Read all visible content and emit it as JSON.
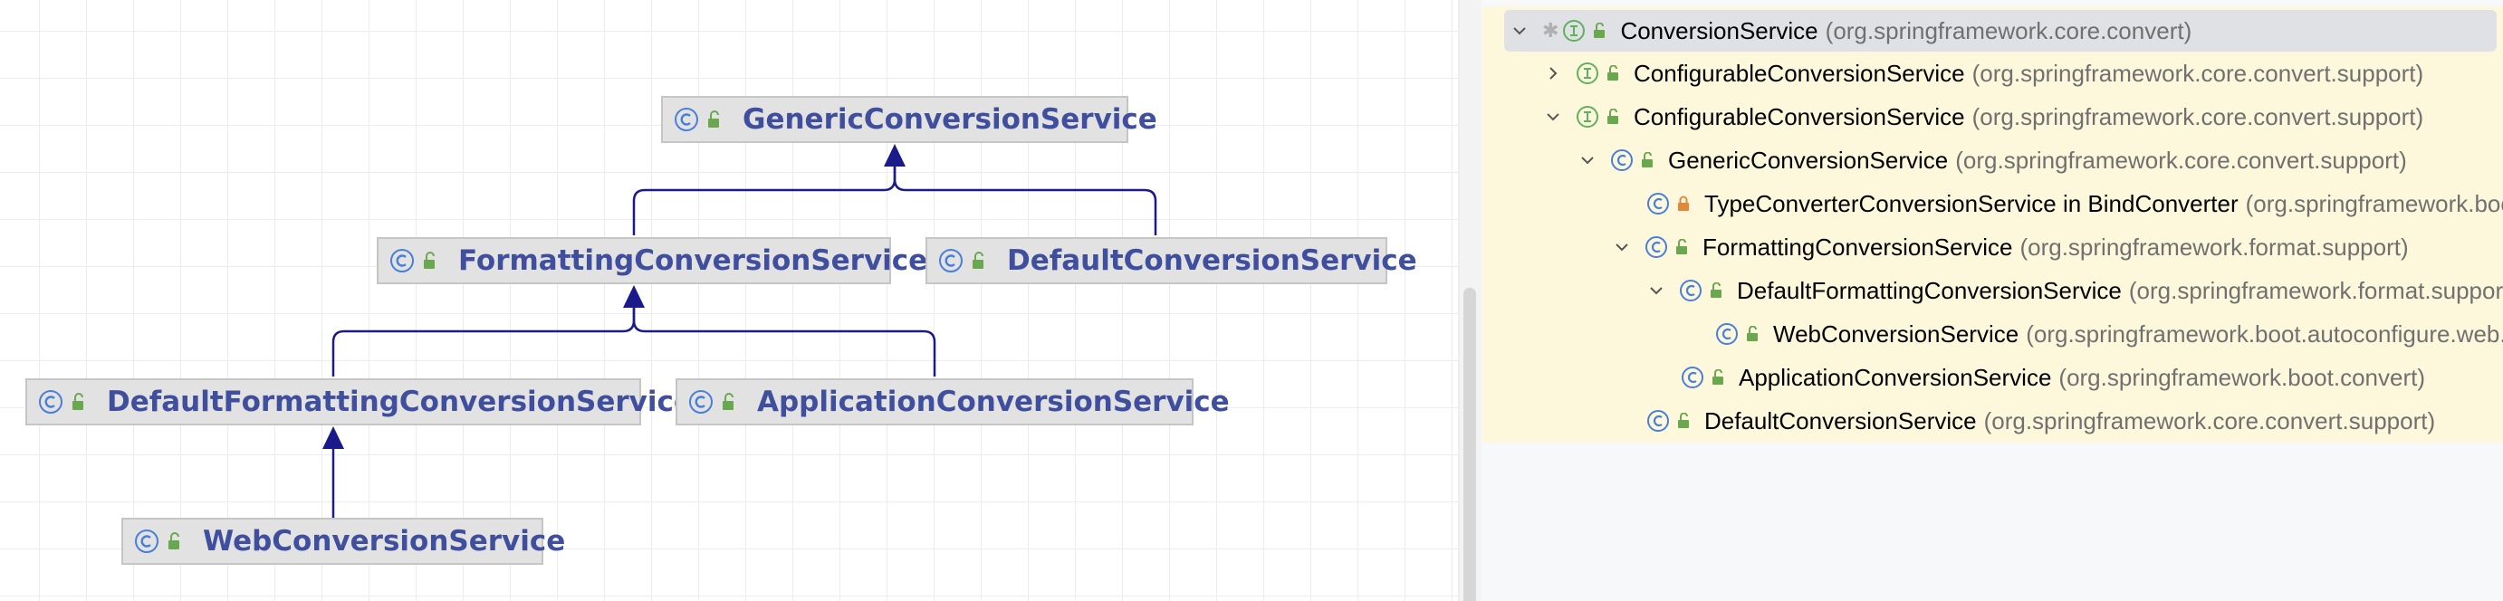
{
  "diagram": {
    "nodes": [
      {
        "id": "generic",
        "label": "GenericConversionService"
      },
      {
        "id": "formatting",
        "label": "FormattingConversionService"
      },
      {
        "id": "default",
        "label": "DefaultConversionService"
      },
      {
        "id": "defaultFormatting",
        "label": "DefaultFormattingConversionService"
      },
      {
        "id": "application",
        "label": "ApplicationConversionService"
      },
      {
        "id": "web",
        "label": "WebConversionService"
      }
    ]
  },
  "tree": {
    "rows": [
      {
        "name": "ConversionService",
        "pkg": "(org.springframework.core.convert)",
        "kind": "interface",
        "expanded": true
      },
      {
        "name": "ConfigurableConversionService",
        "pkg": "(org.springframework.core.convert.support)",
        "kind": "interface",
        "expanded": false
      },
      {
        "name": "ConfigurableConversionService",
        "pkg": "(org.springframework.core.convert.support)",
        "kind": "interface",
        "expanded": true
      },
      {
        "name": "GenericConversionService",
        "pkg": "(org.springframework.core.convert.support)",
        "kind": "class",
        "expanded": true
      },
      {
        "name": "TypeConverterConversionService in BindConverter",
        "pkg": "(org.springframework.boot.context.properties.bind)",
        "kind": "class",
        "private": true
      },
      {
        "name": "FormattingConversionService",
        "pkg": "(org.springframework.format.support)",
        "kind": "class",
        "expanded": true
      },
      {
        "name": "DefaultFormattingConversionService",
        "pkg": "(org.springframework.format.support)",
        "kind": "class",
        "expanded": true
      },
      {
        "name": "WebConversionService",
        "pkg": "(org.springframework.boot.autoconfigure.web.format)",
        "kind": "class"
      },
      {
        "name": "ApplicationConversionService",
        "pkg": "(org.springframework.boot.convert)",
        "kind": "class"
      },
      {
        "name": "DefaultConversionService",
        "pkg": "(org.springframework.core.convert.support)",
        "kind": "class"
      }
    ]
  },
  "colors": {
    "node_label": "#3f4f9e",
    "edge": "#1a1a8a",
    "class_icon": "#4a7fd8",
    "interface_icon": "#5fb15f",
    "tree_bg": "#fdf8dc",
    "selected_row": "#dfe1e5",
    "package_text": "#707070"
  },
  "icons": {
    "class": "class-icon",
    "interface": "interface-icon",
    "public": "unlocked-icon",
    "private": "lock-icon",
    "expanded": "chevron-down-icon",
    "collapsed": "chevron-right-icon",
    "pinned": "star-icon"
  }
}
